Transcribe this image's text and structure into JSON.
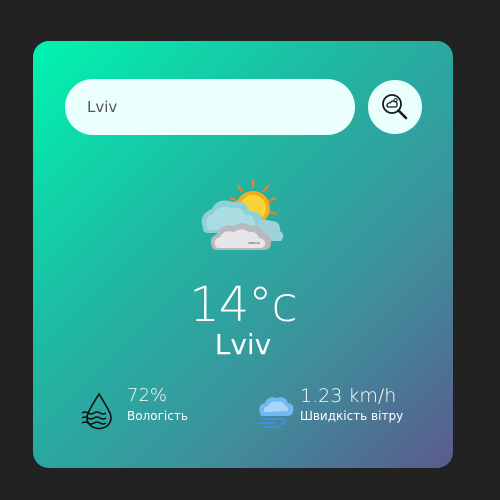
{
  "search": {
    "value": "Lviv",
    "button_icon": "search-weather-icon"
  },
  "weather": {
    "icon": "partly-cloudy-sun-icon",
    "temperature": "14°c",
    "city": "Lviv"
  },
  "details": {
    "humidity": {
      "icon": "humidity-water-drop-icon",
      "value": "72%",
      "label": "Вологість"
    },
    "wind": {
      "icon": "wind-cloud-icon",
      "value": "1.23 km/h",
      "label": "Швидкість вітру"
    }
  },
  "colors": {
    "page_background": "#222222",
    "card_gradient_start": "#00f5b0",
    "card_gradient_end": "#5b5a8c",
    "input_background": "#ebfffc",
    "text": "#ffffff"
  }
}
